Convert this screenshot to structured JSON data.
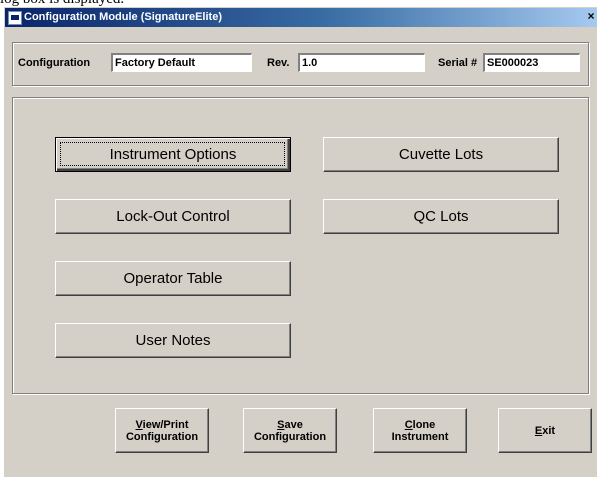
{
  "doc_fragment": "log box is displayed.",
  "window": {
    "title": "Configuration Module (SignatureElite)",
    "close_glyph": "×"
  },
  "config_row": {
    "configuration_label": "Configuration",
    "configuration_value": "Factory Default",
    "rev_label": "Rev.",
    "rev_value": "1.0",
    "serial_label": "Serial #",
    "serial_value": "SE000023"
  },
  "main_buttons": {
    "instrument_options": "Instrument Options",
    "cuvette_lots": "Cuvette Lots",
    "lockout_control": "Lock-Out Control",
    "qc_lots": "QC Lots",
    "operator_table": "Operator Table",
    "user_notes": "User Notes"
  },
  "bottom_buttons": {
    "view_print": {
      "mnemonic": "V",
      "line1_rest": "iew/Print",
      "line2": "Configuration"
    },
    "save": {
      "mnemonic": "S",
      "line1_rest": "ave",
      "line2": "Configuration"
    },
    "clone": {
      "mnemonic": "C",
      "line1_rest": "lone",
      "line2": "Instrument"
    },
    "exit": {
      "mnemonic": "E",
      "rest": "xit"
    }
  }
}
